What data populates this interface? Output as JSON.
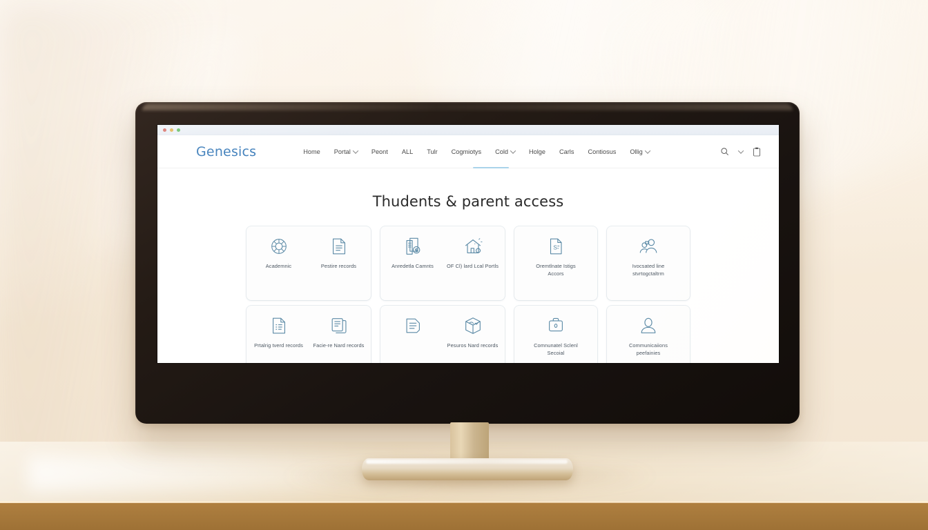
{
  "browser": {
    "traffic_lights": [
      "close",
      "minimize",
      "maximize"
    ]
  },
  "header": {
    "brand": "Genesics",
    "nav_items": [
      {
        "label": "Home",
        "caret": false
      },
      {
        "label": "Portal",
        "caret": true
      },
      {
        "label": "Peont",
        "caret": false
      },
      {
        "label": "ALL",
        "caret": false
      },
      {
        "label": "Tulr",
        "caret": false
      },
      {
        "label": "Cogmiotys",
        "caret": false
      },
      {
        "label": "Cold",
        "caret": true
      },
      {
        "label": "Holge",
        "caret": false
      },
      {
        "label": "Carls",
        "caret": false
      },
      {
        "label": "Contiosus",
        "caret": false
      },
      {
        "label": "Ollig",
        "caret": true
      }
    ],
    "actions": [
      {
        "name": "search-icon",
        "label": "Search"
      },
      {
        "name": "chevron-down-icon",
        "label": "More"
      },
      {
        "name": "clipboard-icon",
        "label": "Clipboard"
      }
    ]
  },
  "page": {
    "title": "Thudents & parent access"
  },
  "cards": [
    {
      "row": 1,
      "width": 2,
      "tiles": [
        {
          "icon": "segmented-circle-icon",
          "label": "Academnic"
        },
        {
          "icon": "document-lines-icon",
          "label": "Pestire records"
        }
      ]
    },
    {
      "row": 1,
      "width": 2,
      "tiles": [
        {
          "icon": "invoice-dollar-icon",
          "label": "Anredetla Camnts"
        },
        {
          "icon": "house-icon",
          "label": "OF Cl) lard Lcal Portls"
        }
      ]
    },
    {
      "row": 1,
      "width": 1,
      "tiles": [
        {
          "icon": "file-s-icon",
          "label": "Oremtlnate Istigs Accors"
        }
      ]
    },
    {
      "row": 1,
      "width": 1,
      "tiles": [
        {
          "icon": "two-people-icon",
          "label": "Ivocsated line stvrtogctaltrm"
        }
      ]
    },
    {
      "row": 2,
      "width": 2,
      "tiles": [
        {
          "icon": "document-list-icon",
          "label": "Prtalrig tverd records"
        },
        {
          "icon": "clipboard-stack-icon",
          "label": "Facie-re Nard records"
        }
      ]
    },
    {
      "row": 2,
      "width": 2,
      "tiles": [
        {
          "icon": "folder-lines-icon",
          "label": ""
        },
        {
          "icon": "cube-icon",
          "label": "Pesuros Nard records"
        }
      ]
    },
    {
      "row": 2,
      "width": 1,
      "tiles": [
        {
          "icon": "briefcase-icon",
          "label": "Comnunatel Sclenl Secoial"
        }
      ]
    },
    {
      "row": 2,
      "width": 1,
      "tiles": [
        {
          "icon": "person-icon",
          "label": "Communicaiions peefainies"
        }
      ]
    }
  ],
  "colors": {
    "brand": "#2f74b5",
    "icon_stroke": "#5b8aa6",
    "nav_underline": "#a9d3ea",
    "desk_edge": "#a87a3c"
  }
}
